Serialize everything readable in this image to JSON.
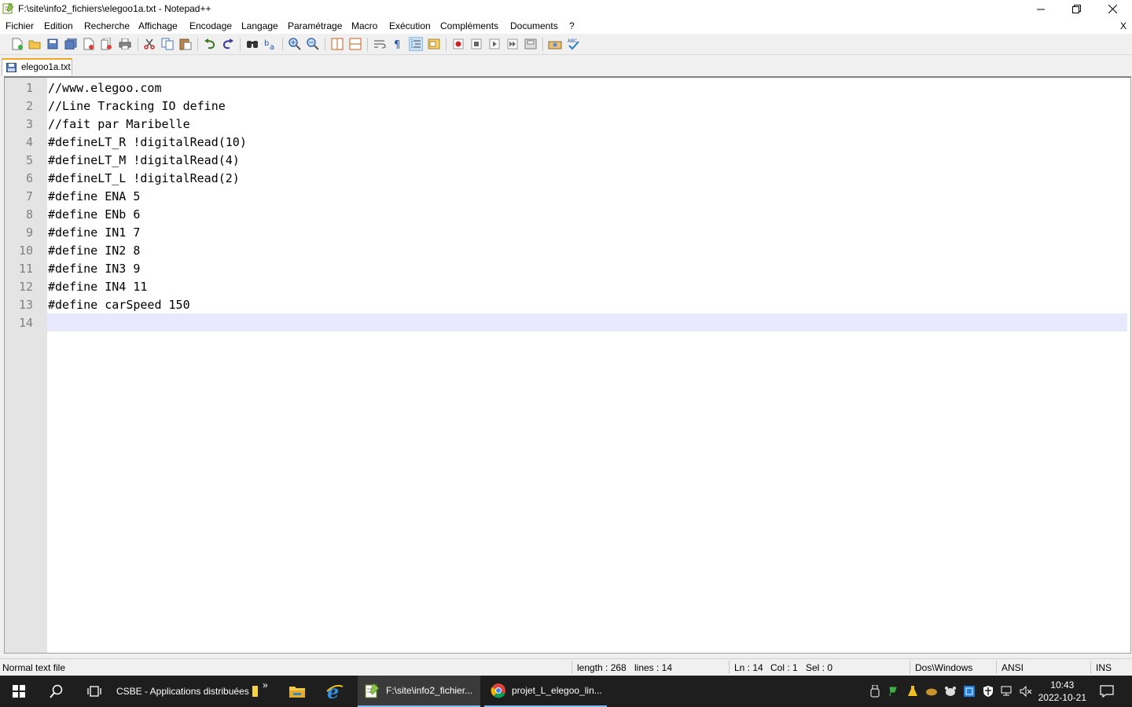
{
  "window": {
    "title": "F:\\site\\info2_fichiers\\elegoo1a.txt - Notepad++",
    "close_doc": "X"
  },
  "menu": [
    "Fichier",
    "Edition",
    "Recherche",
    "Affichage",
    "Encodage",
    "Langage",
    "Paramétrage",
    "Macro",
    "Exécution",
    "Compléments",
    "Documents",
    "?"
  ],
  "tab": {
    "label": "elegoo1a.txt"
  },
  "editor": {
    "lines": [
      {
        "n": "1",
        "text": "//www.elegoo.com"
      },
      {
        "n": "2",
        "text": "//Line Tracking IO define"
      },
      {
        "n": "3",
        "text": "//fait par Maribelle"
      },
      {
        "n": "4",
        "text": "#defineLT_R !digitalRead(10)"
      },
      {
        "n": "5",
        "text": "#defineLT_M !digitalRead(4)"
      },
      {
        "n": "6",
        "text": "#defineLT_L !digitalRead(2)"
      },
      {
        "n": "7",
        "text": "#define ENA 5"
      },
      {
        "n": "8",
        "text": "#define ENb 6"
      },
      {
        "n": "9",
        "text": "#define IN1 7"
      },
      {
        "n": "10",
        "text": "#define IN2 8"
      },
      {
        "n": "11",
        "text": "#define IN3 9"
      },
      {
        "n": "12",
        "text": "#define IN4 11"
      },
      {
        "n": "13",
        "text": "#define carSpeed 150"
      },
      {
        "n": "14",
        "text": ""
      }
    ]
  },
  "status": {
    "file_type": "Normal text file",
    "length": "length : 268",
    "lines": "lines : 14",
    "ln": "Ln : 14",
    "col": "Col : 1",
    "sel": "Sel : 0",
    "eol": "Dos\\Windows",
    "encoding": "ANSI",
    "mode": "INS"
  },
  "taskbar": {
    "folder_label": "CSBE - Applications distribuées",
    "overflow": "»",
    "npp_label": "F:\\site\\info2_fichier...",
    "chrome_label": "projet_L_elegoo_lin...",
    "time": "10:43",
    "date": "2022-10-21"
  }
}
